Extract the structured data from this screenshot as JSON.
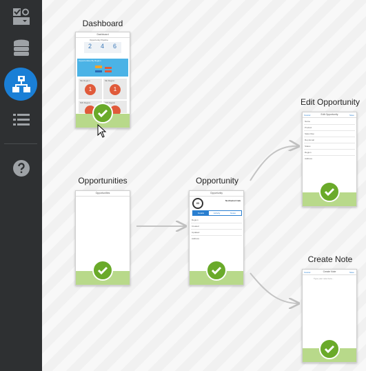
{
  "sidebar": {
    "items": [
      {
        "name": "layout-icon",
        "active": false
      },
      {
        "name": "database-icon",
        "active": false
      },
      {
        "name": "flow-icon",
        "active": true
      },
      {
        "name": "list-icon",
        "active": false
      },
      {
        "name": "help-icon",
        "active": false
      }
    ],
    "accent": "#1a7fd6"
  },
  "nodes": {
    "dashboard": {
      "title": "Dashboard",
      "mini_header": "Dashboard",
      "pipeline_label": "Opportunity Pipeline",
      "pipeline_values": [
        "2",
        "4",
        "6"
      ],
      "chart_label": "Opportunities By Region",
      "regions": [
        "NE Region",
        "SE Region",
        "NW Region",
        "SW Region"
      ],
      "region_value": "1"
    },
    "opportunities": {
      "title": "Opportunities",
      "mini_header": "Opportunities"
    },
    "opportunity": {
      "title": "Opportunity",
      "mini_header": "Opportunity",
      "score": "85",
      "account": "Northwind Cafe",
      "tabs": [
        "Details",
        "Activity",
        "Notes"
      ],
      "fields": [
        "Region",
        "Created",
        "Updated",
        "Address"
      ]
    },
    "edit_opportunity": {
      "title": "Edit Opportunity",
      "mini_header": "Edit Opportunity",
      "cancel": "Cancel",
      "save": "Save",
      "fields": [
        "Name",
        "Product",
        "Sales Rep",
        "Rep Email",
        "Status",
        "Region",
        "Address"
      ]
    },
    "create_note": {
      "title": "Create Note",
      "mini_header": "Create Note",
      "cancel": "Cancel",
      "save": "Save",
      "placeholder": "Type your note here..."
    }
  },
  "colors": {
    "check": "#6aaa2a",
    "bar": "#b8d98a",
    "sidebar": "#2e3032"
  }
}
